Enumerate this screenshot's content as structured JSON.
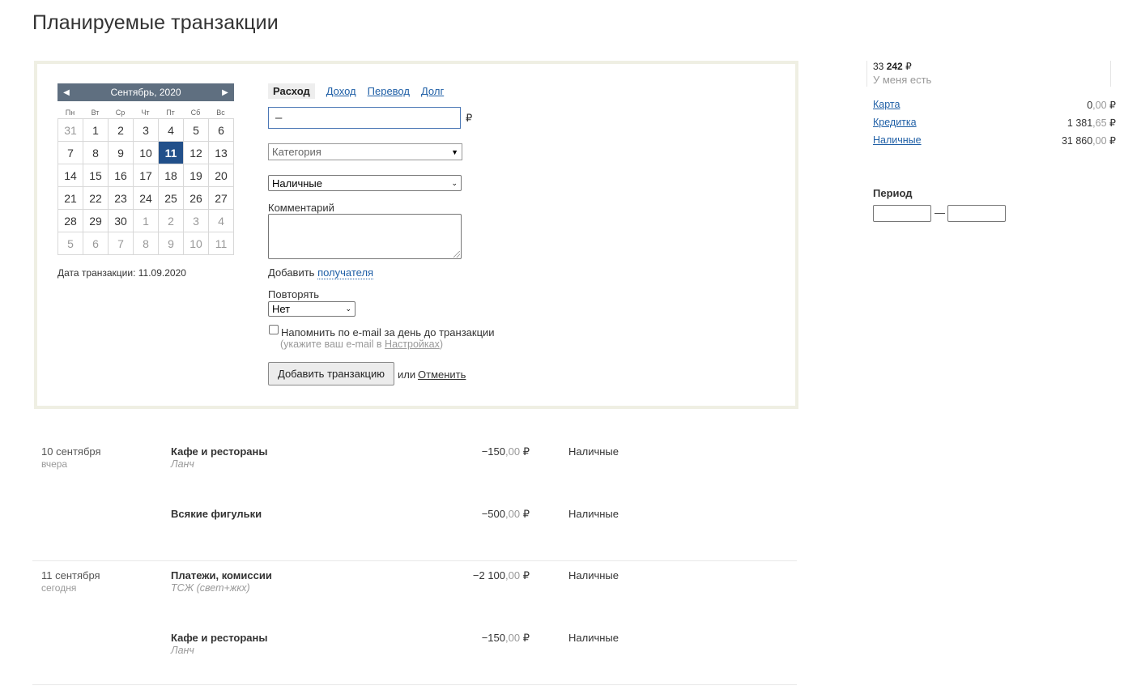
{
  "page": {
    "title": "Планируемые транзакции"
  },
  "calendar": {
    "month_label": "Сентябрь, 2020",
    "prev_icon": "◀",
    "next_icon": "▶",
    "weekdays": [
      "Пн",
      "Вт",
      "Ср",
      "Чт",
      "Пт",
      "Сб",
      "Вс"
    ],
    "days": [
      "31",
      "1",
      "2",
      "3",
      "4",
      "5",
      "6",
      "7",
      "8",
      "9",
      "10",
      "11",
      "12",
      "13",
      "14",
      "15",
      "16",
      "17",
      "18",
      "19",
      "20",
      "21",
      "22",
      "23",
      "24",
      "25",
      "26",
      "27",
      "28",
      "29",
      "30",
      "1",
      "2",
      "3",
      "4",
      "5",
      "6",
      "7",
      "8",
      "9",
      "10",
      "11"
    ],
    "other_month_indices": [
      0,
      31,
      32,
      33,
      34,
      35,
      36,
      37,
      38,
      39,
      40,
      41
    ],
    "selected_index": 11,
    "date_label": "Дата транзакции: 11.09.2020"
  },
  "form": {
    "tabs": [
      "Расход",
      "Доход",
      "Перевод",
      "Долг"
    ],
    "active_tab": "Расход",
    "amount_value": "–",
    "currency": "₽",
    "category_placeholder": "Категория",
    "account_value": "Наличные",
    "comment_label": "Комментарий",
    "add_recipient_prefix": "Добавить",
    "add_recipient_link": "получателя",
    "repeat_label": "Повторять",
    "repeat_value": "Нет",
    "remind_label": "Напомнить по e-mail за день до транзакции",
    "hint_prefix": "(укажите ваш e-mail в ",
    "hint_link": "Настройках",
    "hint_suffix": ")",
    "submit_label": "Добавить транзакцию",
    "or_label": "или",
    "cancel_label": "Отменить"
  },
  "sidebar": {
    "balance_main": "33",
    "balance_bold": "242",
    "balance_currency": "₽",
    "balance_label": "У меня есть",
    "accounts": [
      {
        "name": "Карта",
        "int": "0",
        "dec": ",00",
        "cur": "₽"
      },
      {
        "name": "Кредитка",
        "int": "1 381",
        "dec": ",65",
        "cur": "₽"
      },
      {
        "name": "Наличные",
        "int": "31 860",
        "dec": ",00",
        "cur": "₽"
      }
    ],
    "period_label": "Период",
    "period_dash": "—"
  },
  "transactions": [
    {
      "date": "10 сентября",
      "relative": "вчера",
      "category": "Кафе и рестораны",
      "comment": "Ланч",
      "amount_int": "−150",
      "amount_dec": ",00",
      "currency": "₽",
      "account": "Наличные"
    },
    {
      "date": "",
      "relative": "",
      "category": "Всякие фигульки",
      "comment": "",
      "amount_int": "−500",
      "amount_dec": ",00",
      "currency": "₽",
      "account": "Наличные"
    },
    {
      "date": "11 сентября",
      "relative": "сегодня",
      "category": "Платежи, комиссии",
      "comment": "ТСЖ (свет+жкх)",
      "amount_int": "−2 100",
      "amount_dec": ",00",
      "currency": "₽",
      "account": "Наличные"
    },
    {
      "date": "",
      "relative": "",
      "category": "Кафе и рестораны",
      "comment": "Ланч",
      "amount_int": "−150",
      "amount_dec": ",00",
      "currency": "₽",
      "account": "Наличные"
    }
  ],
  "colors": {
    "link": "#1f5fa6",
    "selected_day": "#22508a",
    "calendar_header": "#5f6f80",
    "panel_border": "#efefe3"
  }
}
